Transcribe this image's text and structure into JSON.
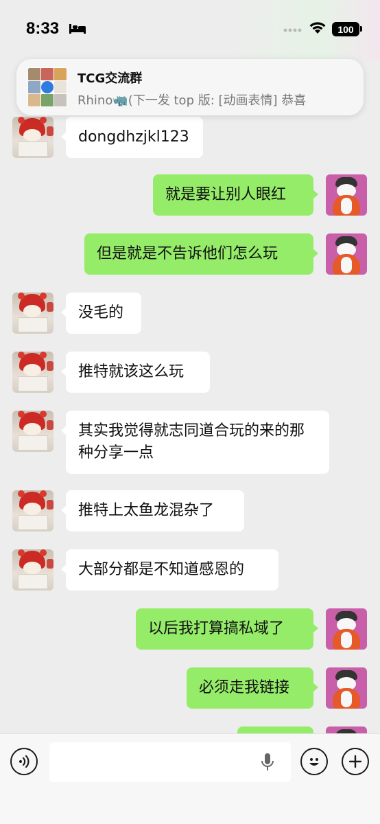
{
  "status_bar": {
    "time": "8:33",
    "battery": "100"
  },
  "notification": {
    "title": "TCG交流群",
    "body": "Rhino🦏(下一发 top 版: [动画表情] 恭喜"
  },
  "messages": [
    {
      "side": "in",
      "text": "dongdhzjkl123"
    },
    {
      "side": "out",
      "text": "就是要让别人眼红"
    },
    {
      "side": "out",
      "text": "但是就是不告诉他们怎么玩"
    },
    {
      "side": "in",
      "text": "没毛的"
    },
    {
      "side": "in",
      "text": "推特就该这么玩"
    },
    {
      "side": "in",
      "text": "其实我觉得就志同道合玩的来的那种分享一点"
    },
    {
      "side": "in",
      "text": "推特上太鱼龙混杂了"
    },
    {
      "side": "in",
      "text": "大部分都是不知道感恩的"
    },
    {
      "side": "out",
      "text": "以后我打算搞私域了"
    },
    {
      "side": "out",
      "text": "必须走我链接"
    }
  ],
  "input_bar": {
    "placeholder": ""
  },
  "colors": {
    "outgoing_bubble": "#95ec69",
    "incoming_bubble": "#ffffff",
    "chat_background": "#ededed"
  }
}
